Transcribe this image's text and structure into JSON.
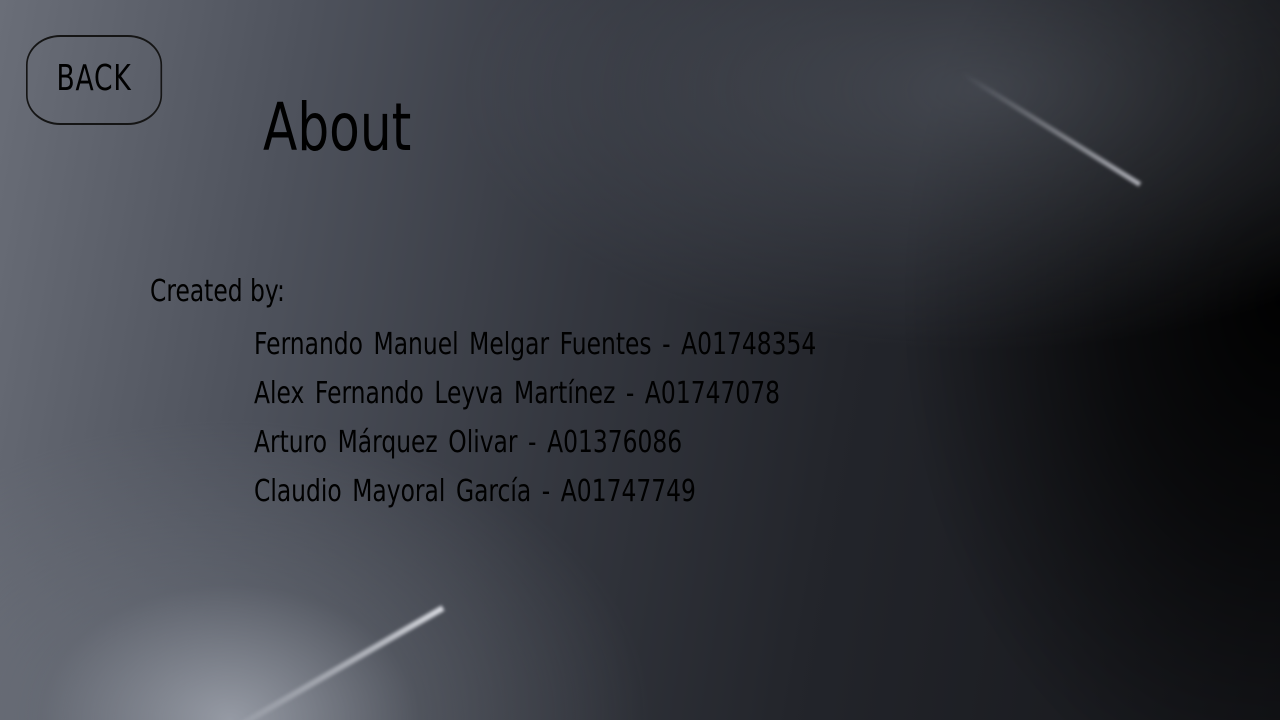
{
  "back_button": {
    "label": "BACK"
  },
  "page": {
    "title": "About"
  },
  "credits": {
    "label": "Created by:",
    "members": [
      "Fernando Manuel Melgar Fuentes - A01748354",
      "Alex Fernando Leyva Martínez - A01747078",
      "Arturo Márquez Olivar - A01376086",
      "Claudio Mayoral García - A01747749"
    ]
  }
}
